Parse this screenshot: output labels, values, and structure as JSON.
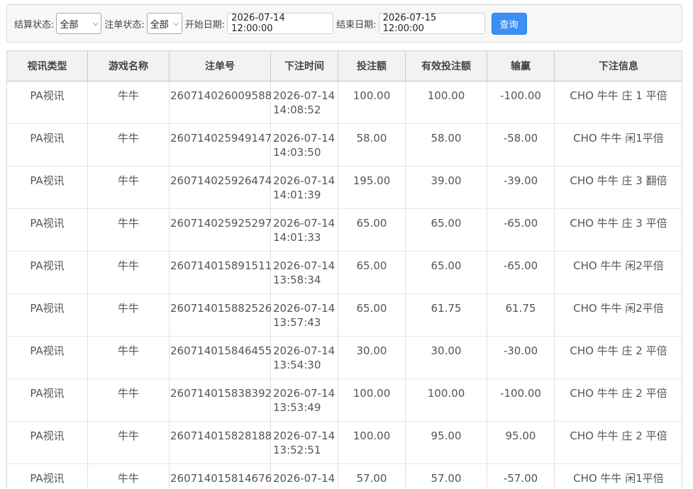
{
  "filters": {
    "settle_label": "结算状态:",
    "settle_value": "全部",
    "order_label": "注单状态:",
    "order_value": "全部",
    "start_label": "开始日期:",
    "start_value": "2026-07-14 12:00:00",
    "end_label": "结束日期:",
    "end_value": "2026-07-15 12:00:00",
    "query_label": "查询"
  },
  "table": {
    "headers": [
      "视讯类型",
      "游戏名称",
      "注单号",
      "下注时间",
      "投注额",
      "有效投注额",
      "输赢",
      "下注信息"
    ],
    "rows": [
      [
        "PA视讯",
        "牛牛",
        "260714026009588",
        "2026-07-14",
        "14:08:52",
        "100.00",
        "100.00",
        "-100.00",
        "CHO 牛牛 庄 1 平倍"
      ],
      [
        "PA视讯",
        "牛牛",
        "260714025949147",
        "2026-07-14",
        "14:03:50",
        "58.00",
        "58.00",
        "-58.00",
        "CHO 牛牛 闲1平倍"
      ],
      [
        "PA视讯",
        "牛牛",
        "260714025926474",
        "2026-07-14",
        "14:01:39",
        "195.00",
        "39.00",
        "-39.00",
        "CHO 牛牛 庄 3 翻倍"
      ],
      [
        "PA视讯",
        "牛牛",
        "260714025925297",
        "2026-07-14",
        "14:01:33",
        "65.00",
        "65.00",
        "-65.00",
        "CHO 牛牛 庄 3 平倍"
      ],
      [
        "PA视讯",
        "牛牛",
        "260714015891511",
        "2026-07-14",
        "13:58:34",
        "65.00",
        "65.00",
        "-65.00",
        "CHO 牛牛 闲2平倍"
      ],
      [
        "PA视讯",
        "牛牛",
        "260714015882526",
        "2026-07-14",
        "13:57:43",
        "65.00",
        "61.75",
        "61.75",
        "CHO 牛牛 闲2平倍"
      ],
      [
        "PA视讯",
        "牛牛",
        "260714015846455",
        "2026-07-14",
        "13:54:30",
        "30.00",
        "30.00",
        "-30.00",
        "CHO 牛牛 庄 2 平倍"
      ],
      [
        "PA视讯",
        "牛牛",
        "260714015838392",
        "2026-07-14",
        "13:53:49",
        "100.00",
        "100.00",
        "-100.00",
        "CHO 牛牛 庄 2 平倍"
      ],
      [
        "PA视讯",
        "牛牛",
        "260714015828188",
        "2026-07-14",
        "13:52:51",
        "100.00",
        "95.00",
        "95.00",
        "CHO 牛牛 庄 2 平倍"
      ],
      [
        "PA视讯",
        "牛牛",
        "260714015814676",
        "2026-07-14",
        "",
        "57.00",
        "57.00",
        "-57.00",
        "CHO 牛牛 闲1平倍"
      ]
    ]
  }
}
